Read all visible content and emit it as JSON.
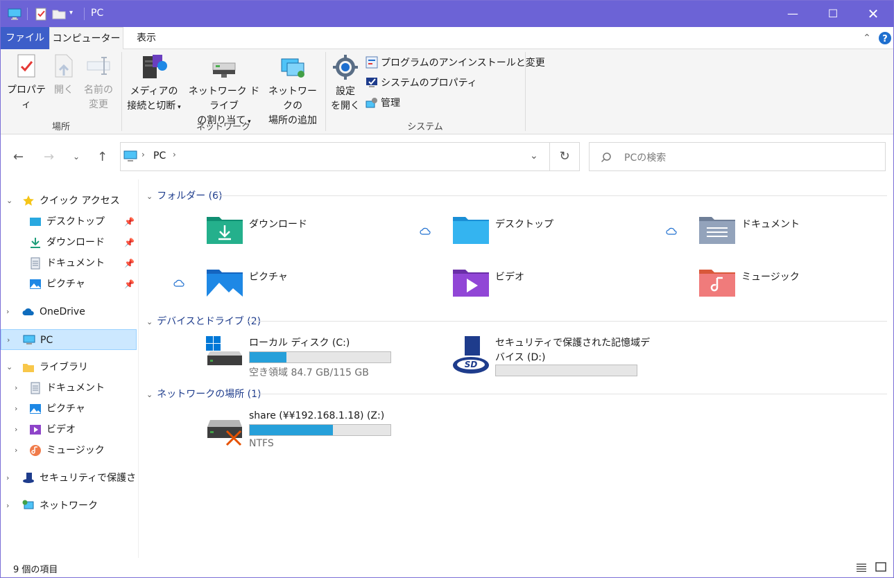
{
  "window": {
    "title": "PC"
  },
  "tabs": {
    "file": "ファイル",
    "computer": "コンピューター",
    "view": "表示"
  },
  "ribbon": {
    "location": {
      "label": "場所",
      "properties": "プロパティ",
      "open": "開く",
      "rename_1": "名前の",
      "rename_2": "変更"
    },
    "network": {
      "label": "ネットワーク",
      "media_1": "メディアの",
      "media_2": "接続と切断",
      "drive_1": "ネットワーク ドライブ",
      "drive_2": "の割り当て",
      "place_1": "ネットワークの",
      "place_2": "場所の追加"
    },
    "system": {
      "label": "システム",
      "settings_1": "設定",
      "settings_2": "を開く",
      "uninstall": "プログラムのアンインストールと変更",
      "sysprops": "システムのプロパティ",
      "manage": "管理"
    }
  },
  "address": {
    "location": "PC",
    "search_placeholder": "PCの検索"
  },
  "nav": {
    "quick_access": "クイック アクセス",
    "desktop": "デスクトップ",
    "downloads": "ダウンロード",
    "documents": "ドキュメント",
    "pictures": "ピクチャ",
    "onedrive": "OneDrive",
    "pc": "PC",
    "libraries": "ライブラリ",
    "lib_documents": "ドキュメント",
    "lib_pictures": "ピクチャ",
    "lib_videos": "ビデオ",
    "lib_music": "ミュージック",
    "secure": "セキュリティで保護された",
    "network": "ネットワーク"
  },
  "content": {
    "folders_header": "フォルダー (6)",
    "folders": {
      "downloads": "ダウンロード",
      "desktop": "デスクトップ",
      "documents": "ドキュメント",
      "pictures": "ピクチャ",
      "videos": "ビデオ",
      "music": "ミュージック"
    },
    "devices_header": "デバイスとドライブ (2)",
    "drive_c": {
      "name": "ローカル ディスク (C:)",
      "free": "空き領域 84.7 GB/115 GB",
      "used_fraction": 0.26
    },
    "drive_d": {
      "name_1": "セキュリティで保護された記憶域デ",
      "name_2": "バイス (D:)",
      "used_fraction": 0
    },
    "network_header": "ネットワークの場所 (1)",
    "share": {
      "name": "share (¥¥192.168.1.18) (Z:)",
      "fs": "NTFS",
      "used_fraction": 0.59
    }
  },
  "status": {
    "count": "9 個の項目"
  },
  "colors": {
    "titlebar": "#6c63d6",
    "file_tab": "#3d5ec9",
    "selection": "#cce8ff",
    "bar_fill": "#26a0da"
  }
}
